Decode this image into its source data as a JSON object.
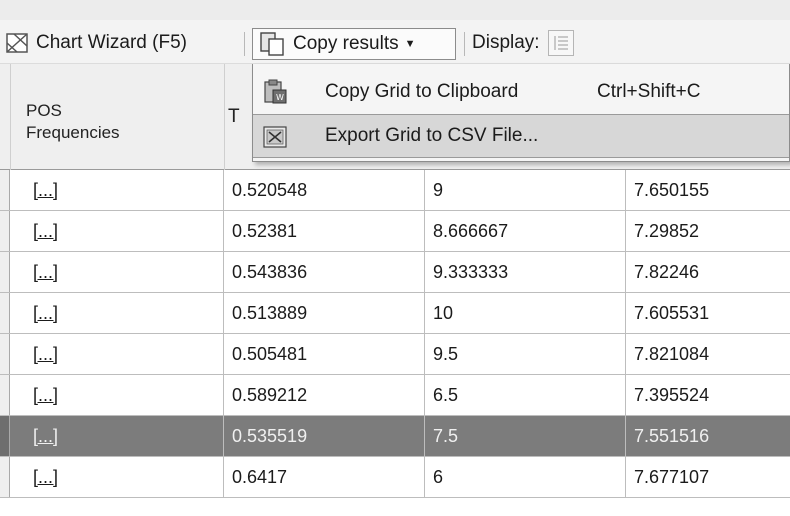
{
  "toolbar": {
    "chart_wizard": "Chart Wizard (F5)",
    "copy_results": "Copy results",
    "display": "Display:"
  },
  "menu": {
    "items": [
      {
        "label": "Copy Grid to Clipboard",
        "shortcut": "Ctrl+Shift+C",
        "icon": "clipboard-icon"
      },
      {
        "label": "Export Grid to CSV File...",
        "shortcut": "",
        "icon": "csv-export-icon"
      }
    ]
  },
  "grid": {
    "headers": [
      "POS\nFrequencies",
      "T"
    ],
    "selected_row_index": 6,
    "rows": [
      [
        "[...]",
        "0.520548",
        "9",
        "7.650155"
      ],
      [
        "[...]",
        "0.52381",
        "8.666667",
        "7.29852"
      ],
      [
        "[...]",
        "0.543836",
        "9.333333",
        "7.82246"
      ],
      [
        "[...]",
        "0.513889",
        "10",
        "7.605531"
      ],
      [
        "[...]",
        "0.505481",
        "9.5",
        "7.821084"
      ],
      [
        "[...]",
        "0.589212",
        "6.5",
        "7.395524"
      ],
      [
        "[...]",
        "0.535519",
        "7.5",
        "7.551516"
      ],
      [
        "[...]",
        "0.6417",
        "6",
        "7.677107"
      ]
    ]
  },
  "colors": {
    "selected_row": "#7c7c7c",
    "menu_highlight": "#d7d7d7",
    "header_bg": "#efefef"
  }
}
